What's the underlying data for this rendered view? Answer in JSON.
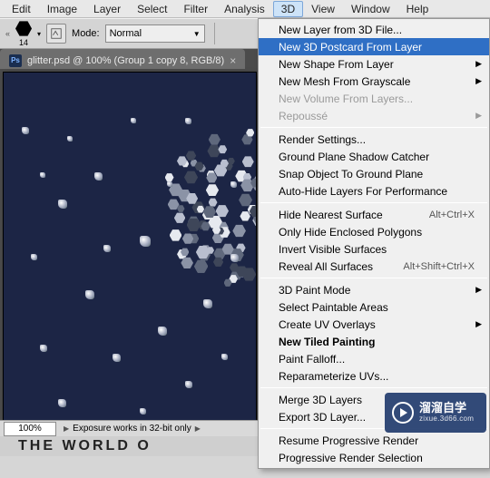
{
  "menubar": {
    "items": [
      "Edit",
      "Image",
      "Layer",
      "Select",
      "Filter",
      "Analysis",
      "3D",
      "View",
      "Window",
      "Help"
    ],
    "open_index": 6
  },
  "optionsbar": {
    "size_value": "14",
    "mode_label": "Mode:",
    "mode_value": "Normal"
  },
  "doc_tab": {
    "icon_text": "Ps",
    "title": "glitter.psd @ 100% (Group 1 copy 8, RGB/8)"
  },
  "statusbar": {
    "zoom": "100%",
    "info": "Exposure works in 32-bit only"
  },
  "bottom_text": "THE WORLD O",
  "dropdown": {
    "groups": [
      [
        {
          "label": "New Layer from 3D File..."
        },
        {
          "label": "New 3D Postcard From Layer",
          "hover": true
        },
        {
          "label": "New Shape From Layer",
          "submenu": true
        },
        {
          "label": "New Mesh From Grayscale",
          "submenu": true
        },
        {
          "label": "New Volume From Layers...",
          "disabled": true
        },
        {
          "label": "Repoussé",
          "submenu": true,
          "disabled": true
        }
      ],
      [
        {
          "label": "Render Settings..."
        },
        {
          "label": "Ground Plane Shadow Catcher"
        },
        {
          "label": "Snap Object To Ground Plane"
        },
        {
          "label": "Auto-Hide Layers For Performance"
        }
      ],
      [
        {
          "label": "Hide Nearest Surface",
          "shortcut": "Alt+Ctrl+X"
        },
        {
          "label": "Only Hide Enclosed Polygons"
        },
        {
          "label": "Invert Visible Surfaces"
        },
        {
          "label": "Reveal All Surfaces",
          "shortcut": "Alt+Shift+Ctrl+X"
        }
      ],
      [
        {
          "label": "3D Paint Mode",
          "submenu": true
        },
        {
          "label": "Select Paintable Areas"
        },
        {
          "label": "Create UV Overlays",
          "submenu": true
        },
        {
          "label": "New Tiled Painting",
          "bold": true
        },
        {
          "label": "Paint Falloff..."
        },
        {
          "label": "Reparameterize UVs..."
        }
      ],
      [
        {
          "label": "Merge 3D Layers"
        },
        {
          "label": "Export 3D Layer..."
        }
      ],
      [
        {
          "label": "Resume Progressive Render"
        },
        {
          "label": "Progressive Render Selection"
        }
      ]
    ]
  },
  "watermark": {
    "cn": "溜溜自学",
    "url": "zixue.3d66.com"
  }
}
